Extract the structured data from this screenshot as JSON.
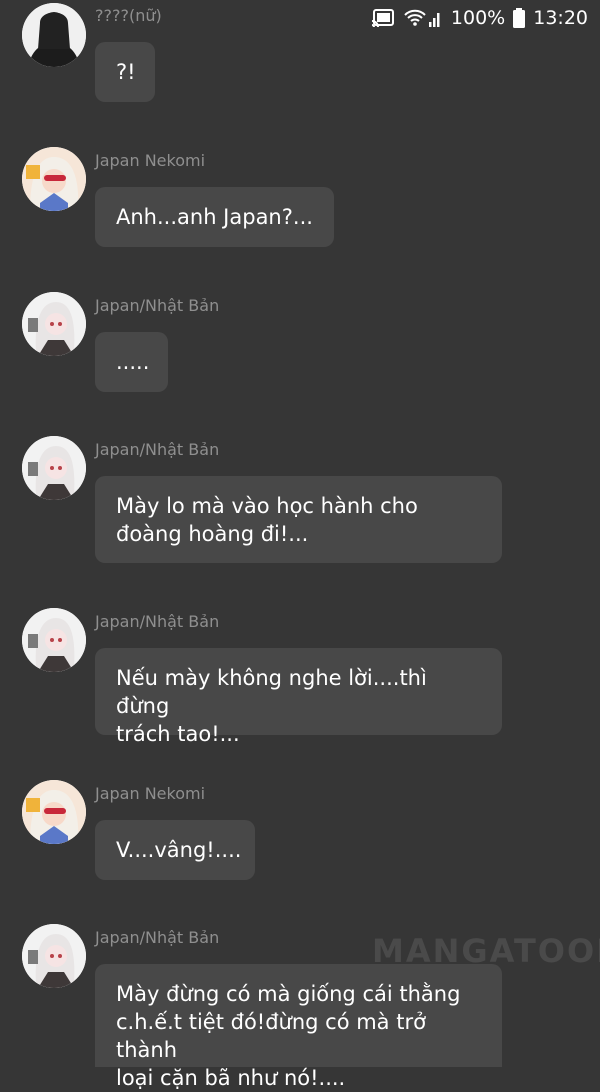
{
  "status_bar": {
    "battery_percent": "100%",
    "time": "13:20"
  },
  "messages": [
    {
      "sender": "????(nữ)",
      "text": "?!",
      "avatar": "silhouette-avatar"
    },
    {
      "sender": "Japan Nekomi",
      "text": "Anh...anh Japan?...",
      "avatar": "nekomi-avatar"
    },
    {
      "sender": "Japan/Nhật Bản",
      "text": ".....",
      "avatar": "japan-avatar"
    },
    {
      "sender": "Japan/Nhật Bản",
      "text": "Mày lo mà vào học hành cho\nđoàng hoàng đi!...",
      "avatar": "japan-avatar"
    },
    {
      "sender": "Japan/Nhật Bản",
      "text": "Nếu mày không nghe lời....thì đừng\ntrách tao!...",
      "avatar": "japan-avatar"
    },
    {
      "sender": "Japan Nekomi",
      "text": "V....vâng!....",
      "avatar": "nekomi-avatar"
    },
    {
      "sender": "Japan/Nhật Bản",
      "text": "Mày đừng có mà giống cái thằng\nc.h.ế.t tiệt đó!đừng có mà trở thành\nloại cặn bã như nó!....",
      "avatar": "japan-avatar"
    }
  ],
  "watermark": "MANGATOON"
}
